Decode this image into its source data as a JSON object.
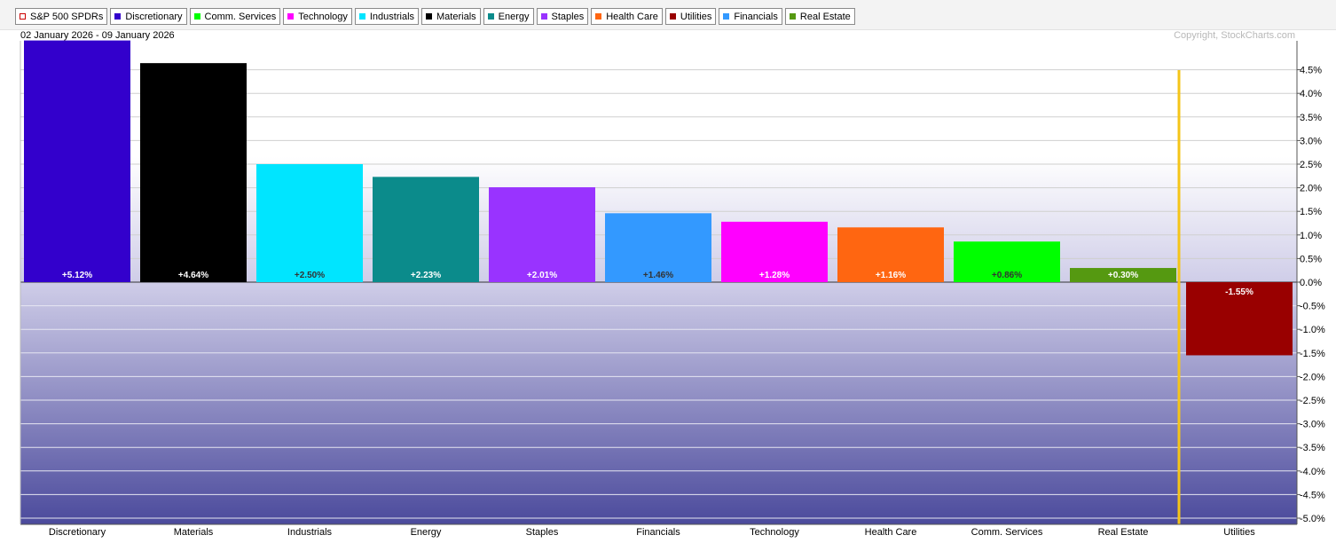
{
  "legend": [
    {
      "label": "S&P 500 SPDRs",
      "color": "#cc0000",
      "hollow": true
    },
    {
      "label": "Discretionary",
      "color": "#3300cc"
    },
    {
      "label": "Comm. Services",
      "color": "#00ff00"
    },
    {
      "label": "Technology",
      "color": "#ff00ff"
    },
    {
      "label": "Industrials",
      "color": "#00e5ff"
    },
    {
      "label": "Materials",
      "color": "#000000"
    },
    {
      "label": "Energy",
      "color": "#0b8b8b"
    },
    {
      "label": "Staples",
      "color": "#9933ff"
    },
    {
      "label": "Health Care",
      "color": "#ff6611"
    },
    {
      "label": "Utilities",
      "color": "#990000"
    },
    {
      "label": "Financials",
      "color": "#3399ff"
    },
    {
      "label": "Real Estate",
      "color": "#559911"
    }
  ],
  "date_range": "02 January 2026 - 09 January 2026",
  "copyright": "Copyright, StockCharts.com",
  "chart_data": {
    "type": "bar",
    "categories": [
      "Discretionary",
      "Materials",
      "Industrials",
      "Energy",
      "Staples",
      "Financials",
      "Technology",
      "Health Care",
      "Comm. Services",
      "Real Estate",
      "Utilities"
    ],
    "values": [
      5.12,
      4.64,
      2.5,
      2.23,
      2.01,
      1.46,
      1.28,
      1.16,
      0.86,
      0.3,
      -1.55
    ],
    "data_labels": [
      "+5.12%",
      "+4.64%",
      "+2.50%",
      "+2.23%",
      "+2.01%",
      "+1.46%",
      "+1.28%",
      "+1.16%",
      "+0.86%",
      "+0.30%",
      "-1.55%"
    ],
    "colors": [
      "#3300cc",
      "#000000",
      "#00e5ff",
      "#0b8b8b",
      "#9933ff",
      "#3399ff",
      "#ff00ff",
      "#ff6611",
      "#00ff00",
      "#559911",
      "#990000"
    ],
    "label_colors": [
      "#ffffff",
      "#ffffff",
      "#333333",
      "#ffffff",
      "#ffffff",
      "#333333",
      "#ffffff",
      "#ffffff",
      "#333333",
      "#ffffff",
      "#ffffff"
    ],
    "ylim": [
      -5.0,
      5.0
    ],
    "yticks": [
      "4.5%",
      "4.0%",
      "3.5%",
      "3.0%",
      "2.5%",
      "2.0%",
      "1.5%",
      "1.0%",
      "0.5%",
      "0.0%",
      "-0.5%",
      "-1.0%",
      "-1.5%",
      "-2.0%",
      "-2.5%",
      "-3.0%",
      "-3.5%",
      "-4.0%",
      "-4.5%",
      "-5.0%"
    ],
    "ytick_values": [
      4.5,
      4.0,
      3.5,
      3.0,
      2.5,
      2.0,
      1.5,
      1.0,
      0.5,
      0.0,
      -0.5,
      -1.0,
      -1.5,
      -2.0,
      -2.5,
      -3.0,
      -3.5,
      -4.0,
      -4.5,
      -5.0
    ],
    "y_axis_position": "right",
    "grid": true,
    "marker_color": "#f5c518",
    "marker_after_category": "Real Estate"
  }
}
